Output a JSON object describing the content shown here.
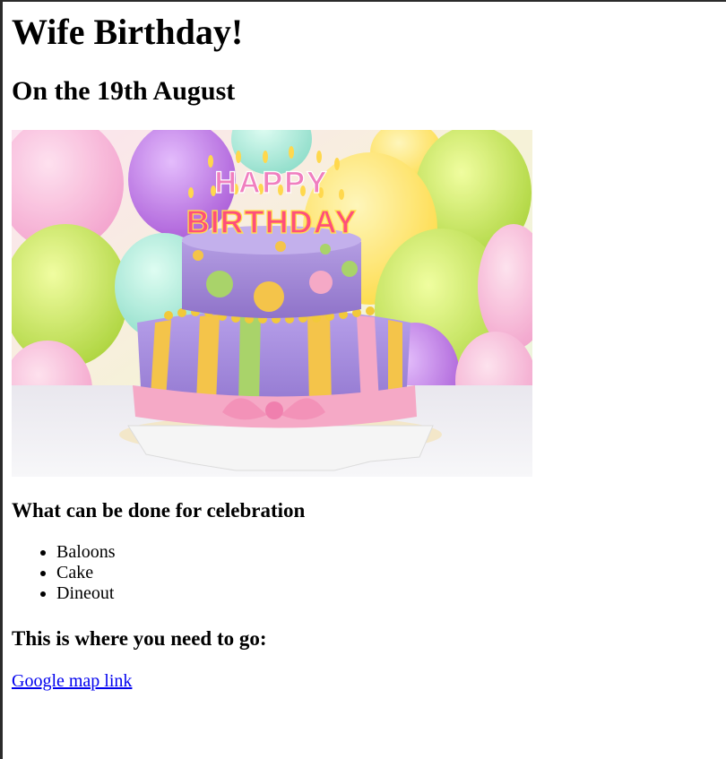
{
  "page": {
    "title": "Wife Birthday!",
    "subtitle": "On the 19th August"
  },
  "image": {
    "cake_text_line1": "HAPPY",
    "cake_text_line2": "BIRTHDAY",
    "colors": {
      "balloon_pink": "#f7b5d7",
      "balloon_purple": "#b56be0",
      "balloon_green": "#b8e04a",
      "balloon_yellow": "#ffe35a",
      "balloon_aqua": "#9ee6d6",
      "cake_purple": "#a88fd6",
      "cake_pink_ribbon": "#f5a9c6",
      "stripe_yellow": "#f4c44a",
      "stripe_green": "#a9d36a"
    }
  },
  "celebration": {
    "heading": "What can be done for celebration",
    "items": [
      "Baloons",
      "Cake",
      "Dineout"
    ]
  },
  "location": {
    "heading": "This is where you need to go:",
    "link_text": "Google map link"
  }
}
